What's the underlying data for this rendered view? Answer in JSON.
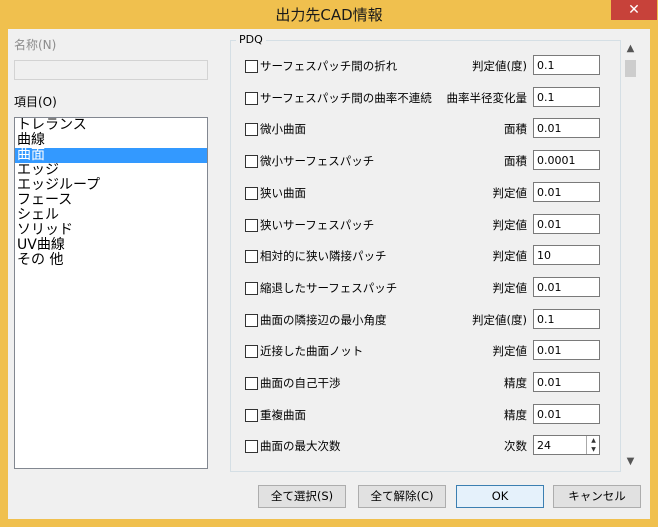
{
  "window": {
    "title": "出力先CAD情報",
    "close_label": "✕"
  },
  "left": {
    "name_label": "名称(N)",
    "items_label": "項目(O)",
    "items": [
      "トレランス",
      "曲線",
      "曲面",
      "エッジ",
      "エッジループ",
      "フェース",
      "シェル",
      "ソリッド",
      "UV曲線",
      "その 他"
    ],
    "selected_index": 2
  },
  "pdq": {
    "title": "PDQ",
    "rows": [
      {
        "label": "サーフェスパッチ間の折れ",
        "param": "判定値(度)",
        "value": "0.1"
      },
      {
        "label": "サーフェスパッチ間の曲率不連続",
        "param": "曲率半径変化量",
        "value": "0.1"
      },
      {
        "label": "微小曲面",
        "param": "面積",
        "value": "0.01"
      },
      {
        "label": "微小サーフェスパッチ",
        "param": "面積",
        "value": "0.0001"
      },
      {
        "label": "狭い曲面",
        "param": "判定値",
        "value": "0.01"
      },
      {
        "label": "狭いサーフェスパッチ",
        "param": "判定値",
        "value": "0.01"
      },
      {
        "label": "相対的に狭い隣接パッチ",
        "param": "判定値",
        "value": "10"
      },
      {
        "label": "縮退したサーフェスパッチ",
        "param": "判定値",
        "value": "0.01"
      },
      {
        "label": "曲面の隣接辺の最小角度",
        "param": "判定値(度)",
        "value": "0.1"
      },
      {
        "label": "近接した曲面ノット",
        "param": "判定値",
        "value": "0.01"
      },
      {
        "label": "曲面の自己干渉",
        "param": "精度",
        "value": "0.01"
      },
      {
        "label": "重複曲面",
        "param": "精度",
        "value": "0.01"
      },
      {
        "label": "曲面の最大次数",
        "param": "次数",
        "value": "24"
      }
    ]
  },
  "buttons": {
    "select_all": "全て選択(S)",
    "deselect_all": "全て解除(C)",
    "ok": "OK",
    "cancel": "キャンセル"
  }
}
